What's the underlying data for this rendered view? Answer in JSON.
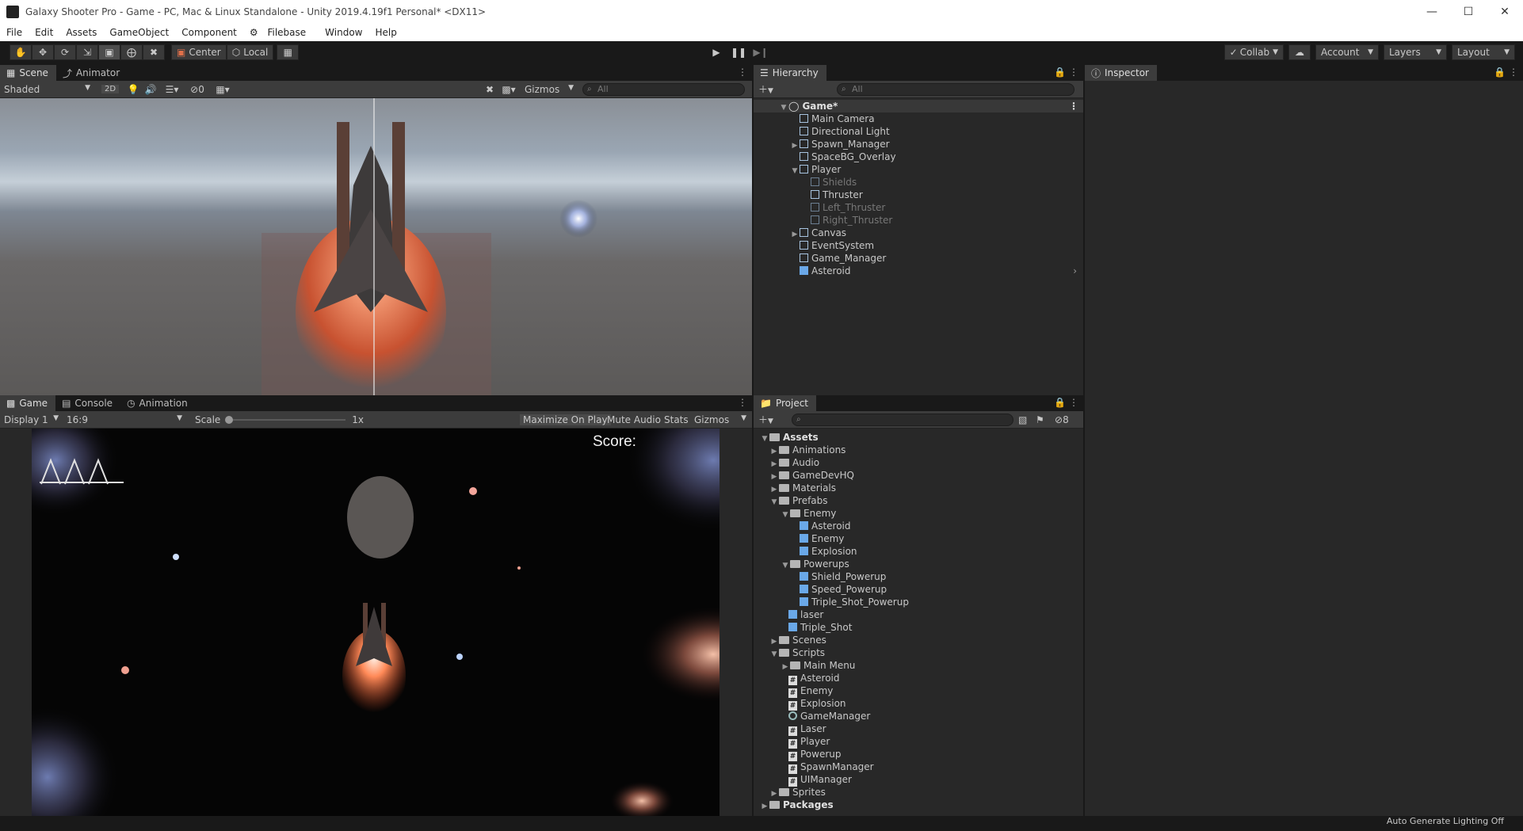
{
  "window": {
    "title": "Galaxy Shooter Pro - Game - PC, Mac & Linux Standalone - Unity 2019.4.19f1 Personal* <DX11>"
  },
  "menu": [
    "File",
    "Edit",
    "Assets",
    "GameObject",
    "Component",
    "Filebase",
    "Window",
    "Help"
  ],
  "toolbar": {
    "center": "Center",
    "local": "Local",
    "collab": "Collab",
    "account": "Account",
    "layers": "Layers",
    "layout": "Layout"
  },
  "scene_panel": {
    "tabs": [
      "Scene",
      "Animator"
    ],
    "shading": "Shaded",
    "mode_2d": "2D",
    "hidden_count": "0",
    "gizmos": "Gizmos",
    "search_placeholder": "All"
  },
  "game_panel": {
    "tabs": [
      "Game",
      "Console",
      "Animation"
    ],
    "display": "Display 1",
    "aspect": "16:9",
    "scale_label": "Scale",
    "scale_value": "1x",
    "maximize": "Maximize On Play",
    "mute": "Mute Audio",
    "stats": "Stats",
    "gizmos": "Gizmos",
    "score_label": "Score:"
  },
  "hierarchy": {
    "tab": "Hierarchy",
    "search_placeholder": "All",
    "scene": "Game*",
    "items": [
      "Main Camera",
      "Directional Light",
      "Spawn_Manager",
      "SpaceBG_Overlay",
      "Player",
      "Shields",
      "Thruster",
      "Left_Thruster",
      "Right_Thruster",
      "Canvas",
      "EventSystem",
      "Game_Manager",
      "Asteroid"
    ]
  },
  "inspector": {
    "tab": "Inspector"
  },
  "project": {
    "tab": "Project",
    "hidden_count": "8",
    "items": [
      "Assets",
      "Animations",
      "Audio",
      "GameDevHQ",
      "Materials",
      "Prefabs",
      "Enemy",
      "Asteroid",
      "Enemy",
      "Explosion",
      "Powerups",
      "Shield_Powerup",
      "Speed_Powerup",
      "Triple_Shot_Powerup",
      "laser",
      "Triple_Shot",
      "Scenes",
      "Scripts",
      "Main Menu",
      "Asteroid",
      "Enemy",
      "Explosion",
      "GameManager",
      "Laser",
      "Player",
      "Powerup",
      "SpawnManager",
      "UIManager",
      "Sprites",
      "Packages"
    ]
  },
  "status": {
    "right": "Auto Generate Lighting Off"
  }
}
